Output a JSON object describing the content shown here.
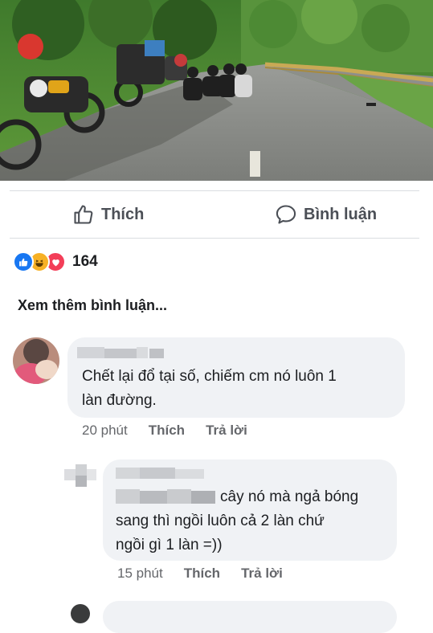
{
  "post": {
    "actions": {
      "like_label": "Thích",
      "comment_label": "Bình luận"
    },
    "reactions": {
      "types": [
        "like-icon",
        "haha-icon",
        "love-icon"
      ],
      "count": "164"
    },
    "view_more_comments": "Xem thêm bình luận..."
  },
  "comments": [
    {
      "text": "Chết lại đổ tại số, chiếm cm nó luôn 1 làn đường.",
      "line1": "Chết lại đổ tại số, chiếm cm nó luôn 1",
      "line2": "làn đường.",
      "time": "20 phút",
      "like_label": "Thích",
      "reply_label": "Trả lời"
    },
    {
      "line1": "cây nó mà ngả bóng",
      "line2": "sang thì ngồi luôn cả 2 làn chứ",
      "line3": "ngồi gì 1 làn =))",
      "time": "15 phút",
      "like_label": "Thích",
      "reply_label": "Trả lời"
    }
  ],
  "colors": {
    "action_text": "#4b4f56",
    "bubble": "#f0f2f5",
    "meta_text": "#65676b",
    "like_blue": "#1877f2",
    "love_red": "#f33e58",
    "haha_yellow": "#f7b125"
  }
}
